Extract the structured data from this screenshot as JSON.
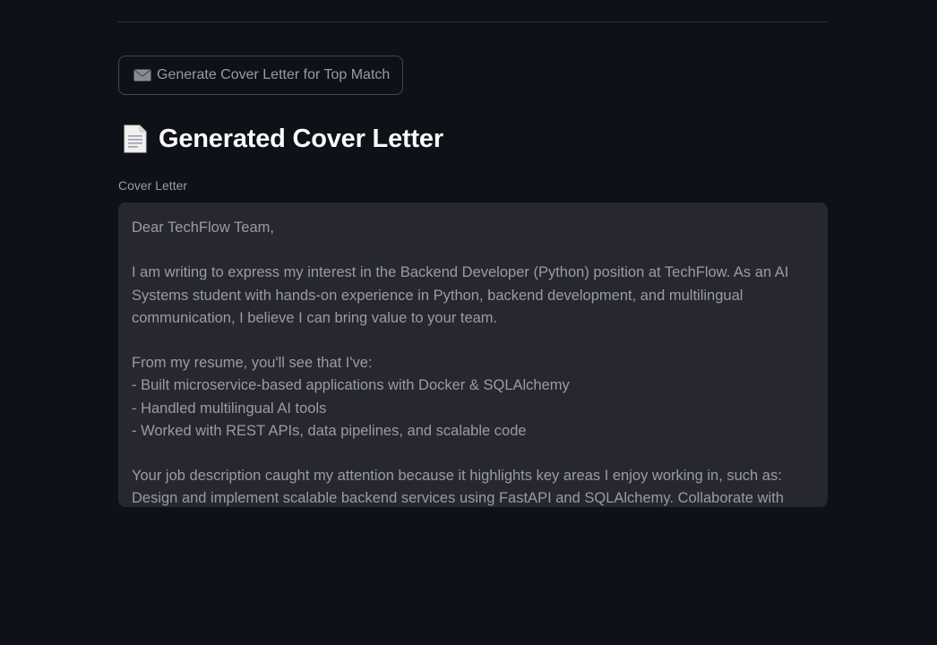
{
  "actions": {
    "generate_button_label": "Generate Cover Letter for Top Match",
    "generate_button_icon": "envelope-icon"
  },
  "section": {
    "title": "Generated Cover Letter",
    "title_icon": "document-icon"
  },
  "cover_letter_field": {
    "label": "Cover Letter",
    "value": "Dear TechFlow Team,\n\nI am writing to express my interest in the Backend Developer (Python) position at TechFlow. As an AI Systems student with hands-on experience in Python, backend development, and multilingual communication, I believe I can bring value to your team.\n\nFrom my resume, you'll see that I've:\n- Built microservice-based applications with Docker & SQLAlchemy\n- Handled multilingual AI tools\n- Worked with REST APIs, data pipelines, and scalable code\n\nYour job description caught my attention because it highlights key areas I enjoy working in, such as:\nDesign and implement scalable backend services using FastAPI and SQLAlchemy. Collaborate with"
  },
  "colors": {
    "background": "#0e1117",
    "field_background": "#262730",
    "text_muted": "#9a9ba3",
    "heading_text": "#fafafa"
  }
}
